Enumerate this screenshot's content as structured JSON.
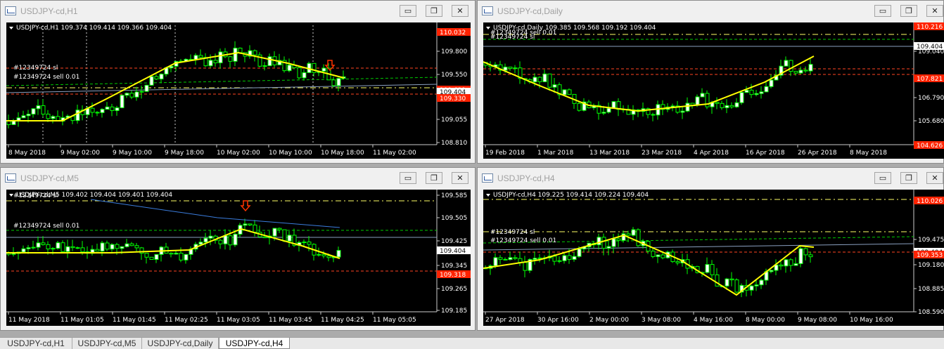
{
  "windows": [
    {
      "title": "USDJPY-cd,H1",
      "info": "USDJPY-cd,H1  109.374 109.414 109.366 109.404",
      "orders": [
        "#12349724 sl",
        "#12349724 sell 0.01"
      ],
      "price_labels": [
        "109.800",
        "109.550",
        "109.300",
        "109.055",
        "108.810"
      ],
      "boxed_prices": [
        {
          "text": "110.032",
          "color": "#ff2200"
        },
        {
          "text": "109.631",
          "color": "#ff2200"
        },
        {
          "text": "109.404",
          "color": "#ffffff"
        },
        {
          "text": "109.330",
          "color": "#ff2200"
        }
      ],
      "time_labels": [
        "8 May 2018",
        "9 May 02:00",
        "9 May 10:00",
        "9 May 18:00",
        "10 May 02:00",
        "10 May 10:00",
        "10 May 18:00",
        "11 May 02:00"
      ]
    },
    {
      "title": "USDJPY-cd,Daily",
      "info": "USDJPY-cd,Daily  109.385 109.568 109.192 109.404",
      "orders": [
        "#12349724 sl",
        "#12349724 sell 0.01"
      ],
      "price_labels": [
        "109.040",
        "106.790",
        "105.680"
      ],
      "boxed_prices": [
        {
          "text": "110.216",
          "color": "#ff2200"
        },
        {
          "text": "109.404",
          "color": "#ffffff"
        },
        {
          "text": "107.821",
          "color": "#ff2200"
        },
        {
          "text": "104.626",
          "color": "#ff2200"
        }
      ],
      "time_labels": [
        "19 Feb 2018",
        "1 Mar 2018",
        "13 Mar 2018",
        "23 Mar 2018",
        "4 Apr 2018",
        "16 Apr 2018",
        "26 Apr 2018",
        "8 May 2018"
      ]
    },
    {
      "title": "USDJPY-cd,M5",
      "info": "USDJPY-cd,M5  109.402 109.404 109.401 109.404",
      "orders": [
        "#12349724 sl",
        "#12349724 sell 0.01"
      ],
      "price_labels": [
        "109.585",
        "109.505",
        "109.425",
        "109.345",
        "109.265",
        "109.185"
      ],
      "boxed_prices": [
        {
          "text": "109.404",
          "color": "#ffffff"
        },
        {
          "text": "109.318",
          "color": "#ff2200"
        }
      ],
      "time_labels": [
        "11 May 2018",
        "11 May 01:05",
        "11 May 01:45",
        "11 May 02:25",
        "11 May 03:05",
        "11 May 03:45",
        "11 May 04:25",
        "11 May 05:05"
      ]
    },
    {
      "title": "USDJPY-cd,H4",
      "info": "USDJPY-cd,H4  109.225 109.414 109.224 109.404",
      "orders": [
        "#12349724 sl",
        "#12349724 sell 0.01"
      ],
      "price_labels": [
        "109.475",
        "109.180",
        "108.885",
        "108.590"
      ],
      "boxed_prices": [
        {
          "text": "110.026",
          "color": "#ff2200"
        },
        {
          "text": "109.404",
          "color": "#ffffff"
        },
        {
          "text": "109.353",
          "color": "#ff2200"
        }
      ],
      "time_labels": [
        "27 Apr 2018",
        "30 Apr 16:00",
        "2 May 00:00",
        "3 May 08:00",
        "4 May 16:00",
        "8 May 00:00",
        "9 May 08:00",
        "10 May 16:00"
      ]
    }
  ],
  "tabs": [
    {
      "label": "USDJPY-cd,H1",
      "active": false
    },
    {
      "label": "USDJPY-cd,M5",
      "active": false
    },
    {
      "label": "USDJPY-cd,Daily",
      "active": false
    },
    {
      "label": "USDJPY-cd,H4",
      "active": true
    }
  ],
  "window_buttons": {
    "minimize": "▭",
    "restore": "❐",
    "close": "✕"
  },
  "colors": {
    "background": "#000000",
    "candle": "#00ff00",
    "candle_bull_body": "#ffffff",
    "moving_average": "#ffff00",
    "sl_line": "#ff4422",
    "order_line": "#00cc00",
    "alt_average": "#3b7ddd",
    "sell_arrow": "#ff3300"
  }
}
